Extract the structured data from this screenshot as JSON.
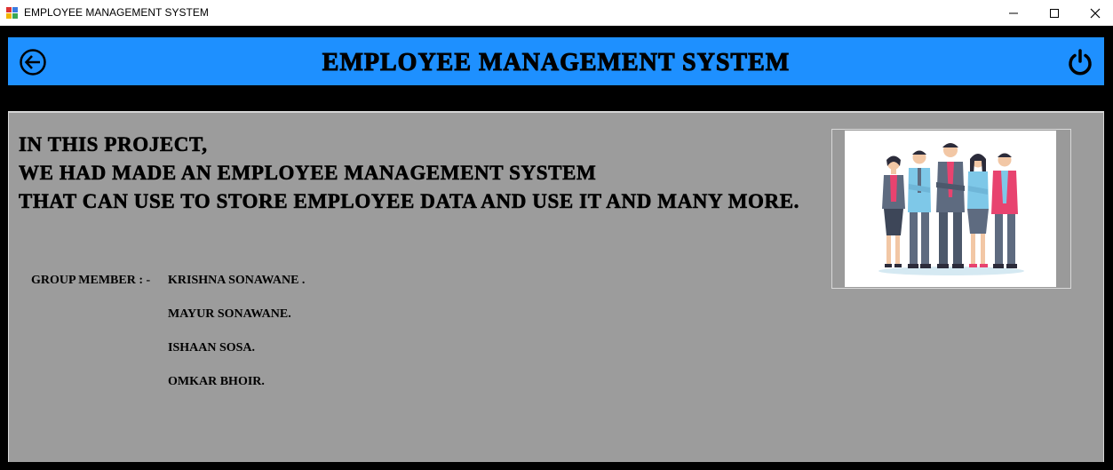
{
  "window": {
    "title": "EMPLOYEE MANAGEMENT SYSTEM"
  },
  "header": {
    "title": "EMPLOYEE MANAGEMENT SYSTEM",
    "back_icon": "back-arrow-icon",
    "power_icon": "power-icon",
    "background": "#1e90ff"
  },
  "content": {
    "intro_lines": [
      "IN THIS PROJECT,",
      "WE HAD MADE AN EMPLOYEE MANAGEMENT SYSTEM",
      "THAT CAN USE TO STORE EMPLOYEE DATA AND USE IT AND MANY MORE."
    ],
    "group_label": "GROUP MEMBER : -",
    "members": [
      "KRISHNA SONAWANE .",
      "MAYUR SONAWANE.",
      "ISHAAN SOSA.",
      "OMKAR BHOIR."
    ],
    "panel_background": "#9c9c9c"
  }
}
